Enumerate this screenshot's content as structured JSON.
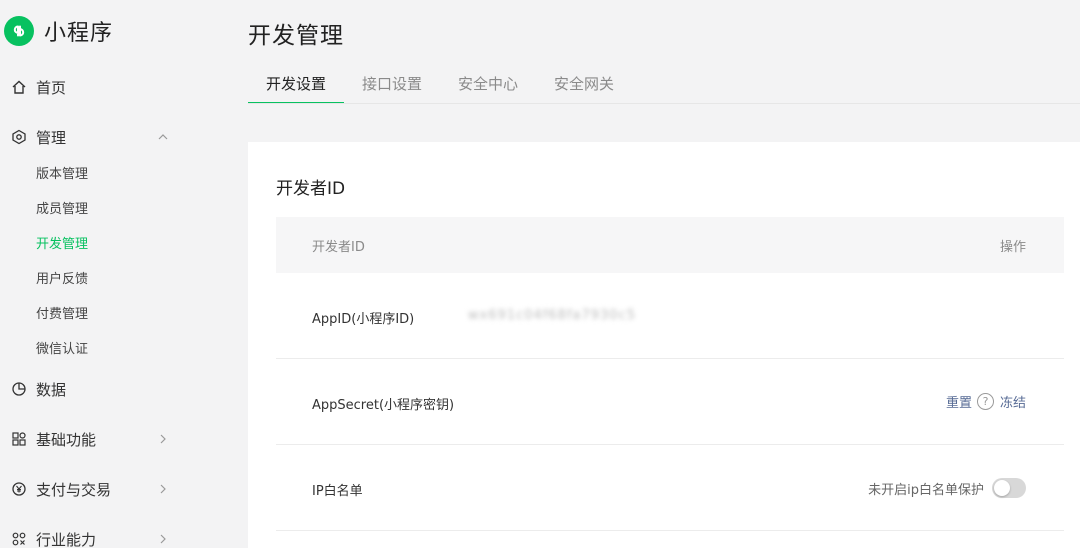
{
  "app": {
    "name": "小程序"
  },
  "sidebar": {
    "home": "首页",
    "manage": {
      "label": "管理",
      "children": [
        "版本管理",
        "成员管理",
        "开发管理",
        "用户反馈",
        "付费管理",
        "微信认证"
      ]
    },
    "data": "数据",
    "basic": "基础功能",
    "payment": "支付与交易",
    "industry": "行业能力"
  },
  "page": {
    "title": "开发管理"
  },
  "tabs": [
    "开发设置",
    "接口设置",
    "安全中心",
    "安全网关"
  ],
  "section": {
    "title": "开发者ID",
    "header": {
      "col1": "开发者ID",
      "col2": "操作"
    },
    "rows": [
      {
        "label": "AppID(小程序ID)",
        "value": "wx691c04f68fa7930c5"
      },
      {
        "label": "AppSecret(小程序密钥)",
        "reset": "重置",
        "freeze": "冻结"
      },
      {
        "label": "IP白名单",
        "status": "未开启ip白名单保护"
      }
    ]
  },
  "colors": {
    "accent": "#07c160",
    "link": "#576b95"
  },
  "icons": {
    "brand": "miniprogram-logo-icon",
    "home": "home-icon",
    "manage": "settings-hexagon-icon",
    "data": "pie-chart-icon",
    "basic": "grid-icon",
    "payment": "yen-coin-icon",
    "industry": "industry-icon",
    "help": "question-circle-icon"
  }
}
